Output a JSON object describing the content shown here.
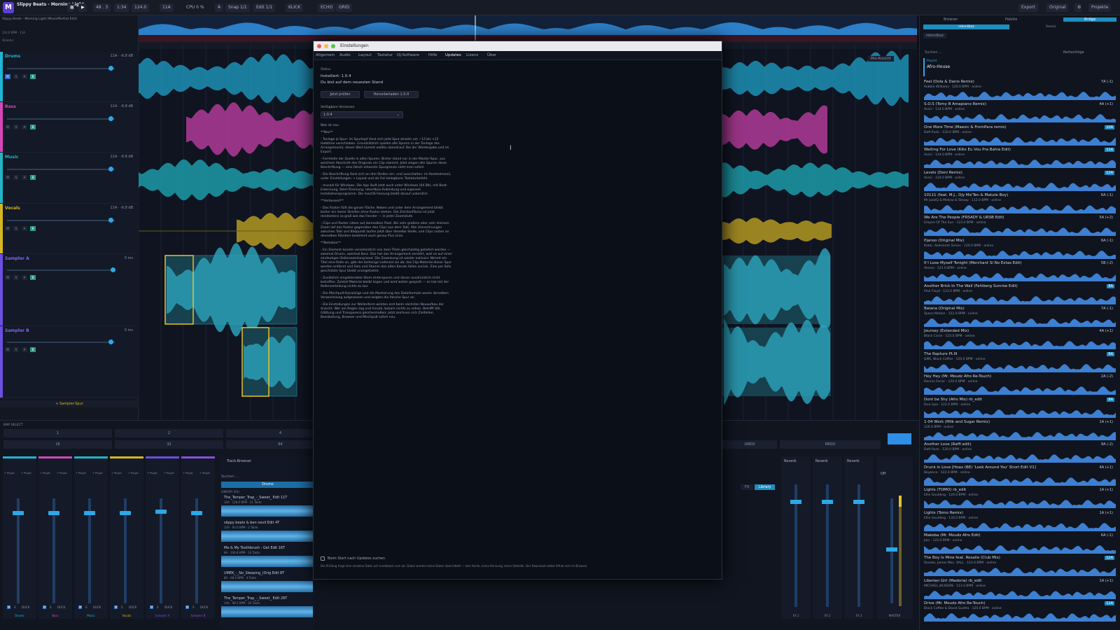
{
  "app": {
    "project_title": "Slippy Beats - Morning Light",
    "subtitle": "Slippy Beats - Morning Light (MusicMixOut Edit)",
    "key_info": "124.0 BPM · 11A",
    "struktur": "Struktur"
  },
  "toolbar": {
    "position": "48 . 3",
    "time": "1:34",
    "bpm": "124.0",
    "key": "11A",
    "cpu": "CPU 0 %",
    "a_label": "A",
    "snap": "Snap 1/1",
    "edit": "Edit 1/1",
    "klick": "KLICK",
    "echo": "ECHO",
    "grid": "GRID",
    "export": "Export",
    "original": "Original",
    "projekte": "Projekte"
  },
  "tracks": [
    {
      "name": "Drums",
      "color": "#1fb5d6",
      "meta": "11A · -6.8 dB"
    },
    {
      "name": "Bass",
      "color": "#d646b8",
      "meta": "11A · -6.8 dB"
    },
    {
      "name": "Music",
      "color": "#20b6c7",
      "meta": "11A · -6.8 dB"
    },
    {
      "name": "Vocals",
      "color": "#d6b620",
      "meta": "11A · -6.8 dB"
    },
    {
      "name": "Sampler A",
      "color": "#6a4fe0",
      "meta": "0 ms"
    },
    {
      "name": "Sampler B",
      "color": "#6a4fe0",
      "meta": "0 ms"
    }
  ],
  "track_buttons": {
    "m": "M",
    "s": "S",
    "a": "A",
    "b": "B"
  },
  "add_sampler": "+ Sampler-Spur",
  "dialog": {
    "title": "Einstellungen",
    "tabs": [
      "Allgemein",
      "Audio",
      "Layout",
      "Tastatur",
      "DJ-Software",
      "Hilfe",
      "Updates",
      "Lizenz",
      "Über"
    ],
    "status_label": "Status",
    "installed": "Installiert: 1.0.4",
    "uptodate": "Du bist auf dem neuesten Stand",
    "check_btn": "Jetzt prüfen",
    "download_btn": "Herunterladen 1.0.4",
    "versions_label": "Verfügbare Versionen",
    "version_value": "1.0.4",
    "whatsnew_label": "Was ist neu",
    "neu_header": "**Neu**",
    "notes_1": "- Tonlage je Spur: im Spurkopf lässt sich jede Spur einzeln um −12 bis +12 Halbtöne verschieben. Grundsätzlich spielen alle Spuren in der Tonlage des Arrangements; dieser Wert kommt additiv obendrauf. Bei der Wiedergabe und im Export.",
    "notes_2": "- Formteile der Quelle in allen Spuren. Bisher stand nur in der Master-Spur, aus welchem Abschnitt des Originals ein Clip stammt. Jetzt zeigen alle Spuren diese Beschriftung — eine falsch erkannte Spurgrenze sieht man sofort.",
    "notes_3": "- Die Beschriftung lässt sich an drei Stellen ein- und ausschalten: im Kontextmenü, unter Einstellungen → Layout und als frei belegbarer Tastaturbefehl.",
    "notes_4": "- musaik für Windows. Die App läuft jetzt auch unter Windows (64 Bit), mit Beat-Erkennung, Stem-Trennung, rekordbox-Anbindung und eigenem Installationsprogramm. Die macOS-Fassung bleibt darauf unberührt.",
    "verbessert_header": "**Verbessert**",
    "notes_5": "- Das Raster füllt die ganze Fläche. Neben und unter dem Arrangement bleibt bisher ein leerer Streifen ohne Raster stehen. Die Zeichenfläche ist jetzt mindestens so groß wie das Fenster — in jeder Zoomstufe.",
    "notes_6": "- Clips und Raster sitzen auf demselben Pixel. Bei sehr großem oder sehr kleinem Zoom lief das Raster gegenüber den Clips aus dem Takt. Alle Umrechnungen zwischen Takt und Bildpunkt laufen jetzt über dieselbe Stelle, und Clips rasten an denselben Rändern bestimmt auch genau Plus Linie.",
    "behoben_header": "**Behoben**",
    "notes_7": "- Ein Element konnte versehentlich von zwei Titeln gleichzeitig geliefert werden — zweimal Drums, zweimal Bass. Das hat das Arrangement zerstört, weil es auf einer eindeutigen Rollenzuteilung baut. Die Zuweisung ist wieder exklusiv: Nimmt ein Titel eine Rolle an, gibt der bisherige Lieferant sie ab; das Clip-Material dieser Spur werden entfernt und Solo und Stumm des alten Kanals fallen zurück. Eine per Solo geschützte Spur bleibt unangetastet.",
    "notes_8": "- Zusätzlich eingeblendete Stem-Unterspuren und davon ausdrücklich nicht betroffen. Zuletzt Material bleibt liegen und wird weiter gespielt — es hat mit der Rollenverteilung nichts zu tun.",
    "notes_9": "- Die Mischpult-Kanalzüge und die Markierung des Dateiformats waren derselben Verwechslung aufgesessen und zeigten die falsche Spur an.",
    "notes_10": "- Die Einstellungen zur Wellenform wirkten erst beim nächsten Neuaufbau der Ansicht. Wer am Regler zog und hinsah, bekam nichts zu sehen. Betrifft Stil, Glättung und Transparenz gleichermaßen; jetzt zeichnen sich Zielfelder, Bearbeitung, Browser und Mischpult sofort neu.",
    "autocheck": "Beim Start nach Updates suchen",
    "footnote": "Die Prüfung fragt eine einzelne Datei auf sondeback.com ab. Dabei werden keine Daten übermittelt — kein Konto, keine Kennung, keine Statistik. Der Download selbst öffnet sich im Browser."
  },
  "browser": {
    "tabs": [
      "Browser",
      "Palette",
      "Bridge"
    ],
    "source": "rekordbox",
    "sub_source": "Sessio",
    "search_placeholder": "Suchen ...",
    "sort": "Reihenfolge",
    "playlist_label": "Playlist",
    "playlist_name": "Afro-House",
    "songs": [
      {
        "title": "Feel (Dola & Danis Remix)",
        "sub": "Robbie Williams · 120.0 BPM · online",
        "key": "7A (-1)",
        "hl": false
      },
      {
        "title": "S.O.S (Tomy B Amapiano Remix)",
        "sub": "Avicii · 114.0 BPM · online",
        "key": "4A (+1)",
        "hl": false
      },
      {
        "title": "One More Time (Maesic & FromPara remix)",
        "sub": "Daft Punk · 120.0 BPM · online",
        "key": "10A",
        "hl": true
      },
      {
        "title": "Waiting For Love (Kiks Eu Vou Pra Bahia Edit)",
        "sub": "Avicii · 124.0 BPM · online",
        "key": "11A",
        "hl": true
      },
      {
        "title": "Levels (Deni Remix)",
        "sub": "Avicii · 120.0 BPM · online",
        "key": "12A",
        "hl": true
      },
      {
        "title": "10111 (feat. M.J., Djy Ma'Ten & Matute Boy)",
        "sub": "Mr JazziQ & Mellow & Sleazy · 112.0 BPM · online",
        "key": "6A (-1)",
        "hl": false
      },
      {
        "title": "We Are The People (FRSADY & URSB Edit)",
        "sub": "Empire Of The Sun · 123.0 BPM · online",
        "key": "5A (+2)",
        "hl": false
      },
      {
        "title": "Pjanoo (Original Mix)",
        "sub": "Katar, Aleksandr Sirnov · 120.0 BPM · online",
        "key": "6A (-1)",
        "hl": false
      },
      {
        "title": "If I Lose Myself Tonight (Merchant Si No Extas Edit)",
        "sub": "Alesso · 123.0 BPM · online",
        "key": "5B (-2)",
        "hl": false
      },
      {
        "title": "Another Brick In The Wall (Fahlberg Sunrise Edit)",
        "sub": "Pink Floyd · 123.0 BPM · online",
        "key": "8A",
        "hl": true
      },
      {
        "title": "Baiana (Original Mix)",
        "sub": "Space Motion · 122.0 BPM · online",
        "key": "7A (-1)",
        "hl": false
      },
      {
        "title": "Journey (Extended Mix)",
        "sub": "Black Circle · 123.0 BPM · online",
        "key": "4A (+1)",
        "hl": false
      },
      {
        "title": "The Rapture Pt.III",
        "sub": "&ME, Black Coffee · 120.0 BPM · online",
        "key": "8A",
        "hl": true
      },
      {
        "title": "Hey Hey (Mr. Moudz Afro Re-Touch)",
        "sub": "Dennis Ferrer · 120.0 BPM · online",
        "key": "2A (-2)",
        "hl": false
      },
      {
        "title": "Dont be Shy (Afro Mix) rb_edit",
        "sub": "Dua Lipa · 122.0 BPM · online",
        "key": "8A",
        "hl": true
      },
      {
        "title": "1-04 Work (Milk and Sugar Remix)",
        "sub": "126.0 BPM · online",
        "key": "1A (+1)",
        "hl": false
      },
      {
        "title": "Another Love (Raffi edit)",
        "sub": "Daft Punk · 120.0 BPM · online",
        "key": "9A (-2)",
        "hl": false
      },
      {
        "title": "Drunk in Love [Hoax (BE) 'Look Around You' Short Edit V1]",
        "sub": "Beyonce · 122.0 BPM · online",
        "key": "4A (+1)",
        "hl": false
      },
      {
        "title": "Lights (TOMO) rb_edit",
        "sub": "Ellie Goulding · 120.0 BPM · online",
        "key": "1A (+1)",
        "hl": false
      },
      {
        "title": "Lights (Tomo Remix)",
        "sub": "Ellie Goulding · 120.0 BPM · online",
        "key": "1A (+1)",
        "hl": false
      },
      {
        "title": "Makeba (Mr. Moudz Afro Edit)",
        "sub": "Jain · 122.0 BPM · online",
        "key": "6A (-1)",
        "hl": false
      },
      {
        "title": "The Boy Is Mine feat. Rosalie (Club Mix)",
        "sub": "Rosalie, James Mac, VALL · 123.0 BPM · online",
        "key": "12A",
        "hl": true
      },
      {
        "title": "Liberian Girl (Madoria) rb_edit",
        "sub": "MICHAEL JACKSON · 113.0 BPM · online",
        "key": "1A (+1)",
        "hl": false
      },
      {
        "title": "Drive (Mr. Moudz Afro Re-Touch)",
        "sub": "Black Coffee & David Guetta · 120.0 BPM · online",
        "key": "11A",
        "hl": true
      }
    ]
  },
  "bottom": {
    "bar_select": "BAR SELECT",
    "pads_row1": [
      "1",
      "2",
      "4"
    ],
    "pads_row2": [
      "16",
      "32",
      "64"
    ],
    "undo": "UNDO",
    "redo": "REDO",
    "track_browser": "Track-Browser",
    "search": "Suchen ...",
    "drums_tab": "Drums",
    "library_btn": "Library",
    "fx_btn": "FX",
    "library_label": "LIBRARY (93)",
    "lib_items": [
      {
        "title": "The_Temper_Trap_-_Sweet_ Edit 11T",
        "sub": "10A · 128.0 BPM · 11 Takte"
      },
      {
        "title": "slippy beats & ben nevil Edit 4T",
        "sub": "10A · 93.0 BPM · 2 Takte"
      },
      {
        "title": "Me & My Toothbrush - Get Edit 16T",
        "sub": "8A · 106.8 BPM · 14 Takte"
      },
      {
        "title": "UMEK_-_No_Sleeping_(Orig Edit 8T",
        "sub": "8A · 68.0 BPM · 4 Takte"
      },
      {
        "title": "The_Temper_Trap_-_Sweet_ Edit 26T",
        "sub": "10A · 98.5 BPM · 20 Takte"
      }
    ],
    "channels": [
      {
        "label": "Drums",
        "color": "#1fb5d6"
      },
      {
        "label": "Bass",
        "color": "#d646b8"
      },
      {
        "label": "Music",
        "color": "#20b6c7"
      },
      {
        "label": "Vocals",
        "color": "#d6b620"
      },
      {
        "label": "Sampler A",
        "color": "#6a4fe0"
      },
      {
        "label": "Sampler B",
        "color": "#8a4fe0"
      }
    ],
    "duck": "DUCK",
    "plugin": "+ Plugin",
    "fx": [
      {
        "name": "Reverb",
        "label": "FX 1"
      },
      {
        "name": "Reverb",
        "label": "FX 2"
      },
      {
        "name": "Reverb",
        "label": "FX 3"
      }
    ],
    "master_off": "Off",
    "master_label": "MASTER",
    "mix_ansicht": "Mix-Ansicht"
  }
}
